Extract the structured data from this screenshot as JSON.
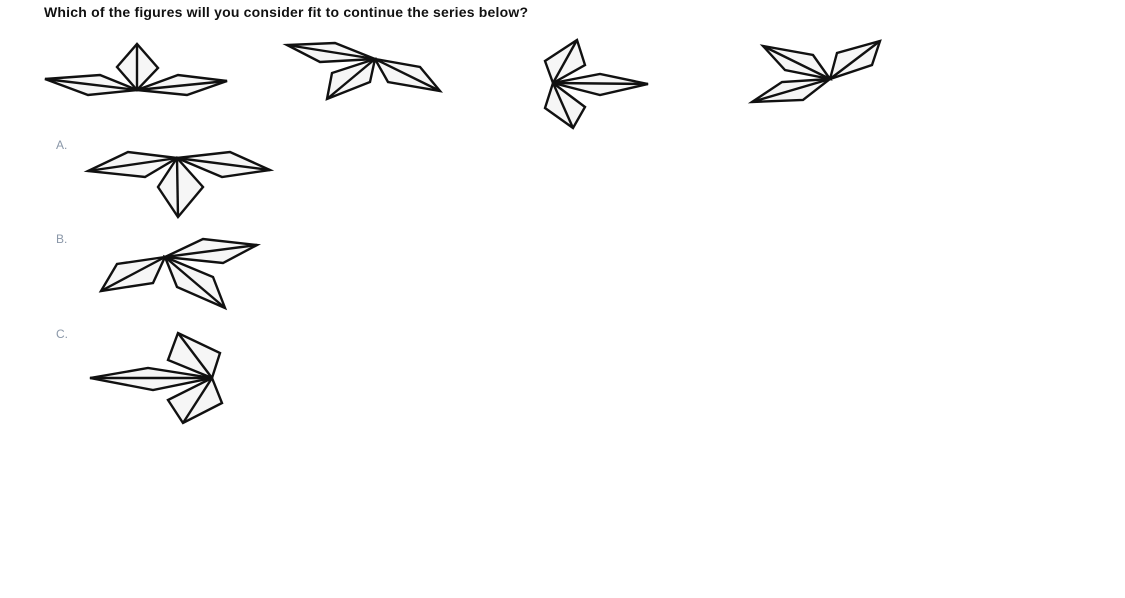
{
  "question": "Which of the figures will you consider fit to continue the series below?",
  "series_figures": [
    "figure-1",
    "figure-2",
    "figure-3",
    "figure-4"
  ],
  "options": [
    {
      "label": "A."
    },
    {
      "label": "B."
    },
    {
      "label": "C."
    }
  ]
}
